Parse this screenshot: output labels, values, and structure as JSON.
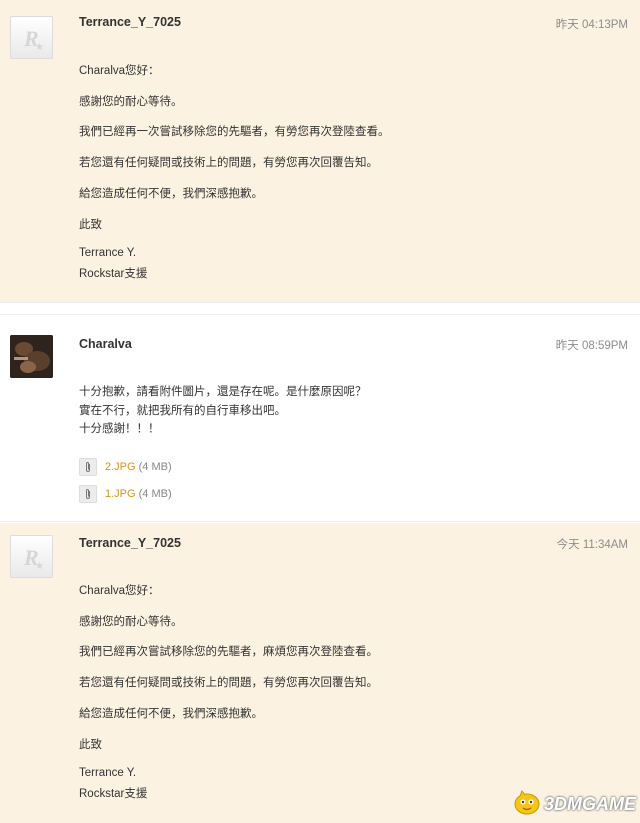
{
  "messages": [
    {
      "author": "Terrance_Y_7025",
      "time": "昨天 04:13PM",
      "avatar_icon": "rockstar-logo-icon",
      "lines": [
        "Charalva您好：",
        "感謝您的耐心等待。",
        "我們已經再一次嘗試移除您的先驅者，有勞您再次登陸查看。",
        "若您還有任何疑問或技術上的問題，有勞您再次回覆告知。",
        "給您造成任何不便，我們深感抱歉。",
        "此致",
        "Terrance Y.",
        "Rockstar支援"
      ]
    },
    {
      "author": "Charalva",
      "time": "昨天 08:59PM",
      "avatar_icon": "user-photo-avatar",
      "lines": [
        "十分抱歉，請看附件圖片，還是存在呢。是什麼原因呢？",
        "實在不行，就把我所有的自行車移出吧。",
        "十分感謝！！！"
      ],
      "attachments": [
        {
          "name": "2.JPG",
          "size": "(4 MB)"
        },
        {
          "name": "1.JPG",
          "size": "(4 MB)"
        }
      ]
    },
    {
      "author": "Terrance_Y_7025",
      "time": "今天 11:34AM",
      "avatar_icon": "rockstar-logo-icon",
      "lines": [
        "Charalva您好：",
        "感謝您的耐心等待。",
        "我們已經再次嘗試移除您的先驅者，麻煩您再次登陸查看。",
        "若您還有任何疑問或技術上的問題，有勞您再次回覆告知。",
        "給您造成任何不便，我們深感抱歉。",
        "此致",
        "Terrance Y.",
        "Rockstar支援"
      ]
    }
  ],
  "watermark": {
    "text": "3DMGAME",
    "icon": "3dm-mascot-icon"
  },
  "colors": {
    "agent_bg": "#fbf2e1",
    "attachment_link": "#d9921f"
  }
}
